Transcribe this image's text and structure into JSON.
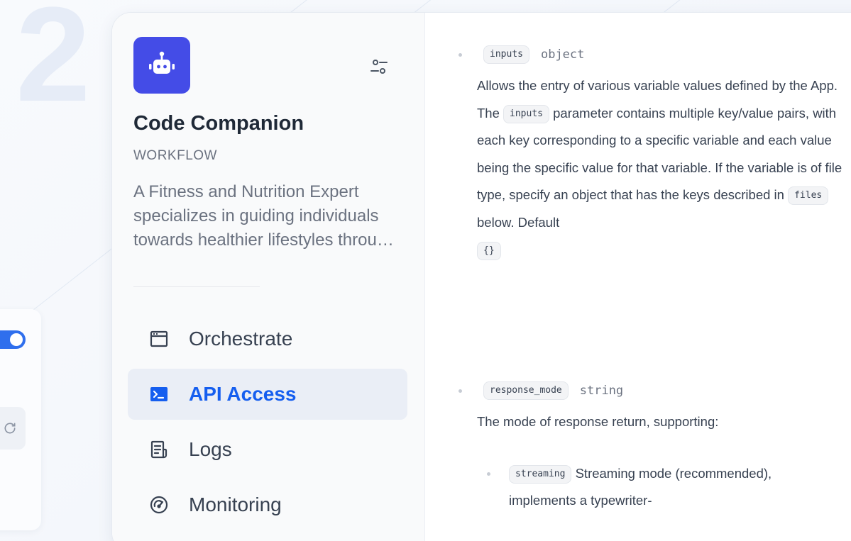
{
  "step_number": "2",
  "app": {
    "name": "Code Companion",
    "type": "WORKFLOW",
    "description": "A Fitness and Nutrition Expert specializes in guiding individuals towards healthier lifestyles through personalized nutrition and exercise plans."
  },
  "nav": {
    "items": [
      {
        "label": "Orchestrate",
        "icon": "window-icon",
        "active": false
      },
      {
        "label": "API Access",
        "icon": "terminal-icon",
        "active": true
      },
      {
        "label": "Logs",
        "icon": "document-list-icon",
        "active": false
      },
      {
        "label": "Monitoring",
        "icon": "gauge-icon",
        "active": false
      }
    ]
  },
  "docs": {
    "params": [
      {
        "name": "inputs",
        "type": "object",
        "desc_1": "Allows the entry of various variable values defined by the App. The",
        "inline_code_1": "inputs",
        "desc_2": "parameter contains multiple key/value pairs, with each key corresponding to a specific variable and each value being the specific value for that variable. If the variable is of file type, specify an object that has the keys described in",
        "inline_code_2": "files",
        "desc_3": "below. Default",
        "default_code": "{}"
      },
      {
        "name": "response_mode",
        "type": "string",
        "description": "The mode of response return, supporting:",
        "options": [
          {
            "code": "streaming",
            "text": "Streaming mode (recommended), implements a typewriter-"
          }
        ]
      }
    ]
  },
  "colors": {
    "accent": "#155eef",
    "app_icon_bg": "#444ce7",
    "toggle": "#2f6fed"
  }
}
